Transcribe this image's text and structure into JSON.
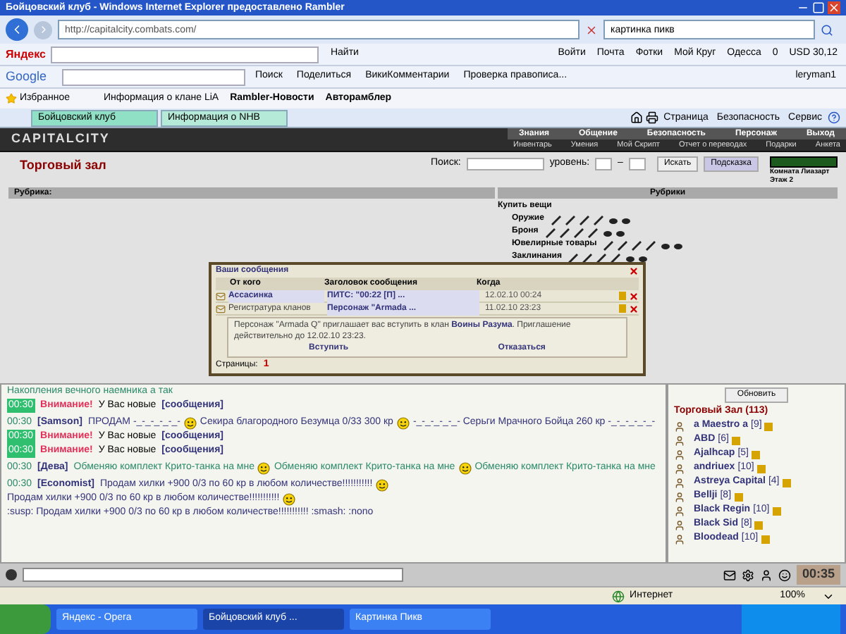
{
  "window": {
    "title": "Бойцовский клуб - Windows Internet Explorer предоставлено Rambler"
  },
  "address_bar": {
    "url": "http://capitalcity.combats.com/",
    "search_value": "картинка пикв"
  },
  "yandex_toolbar": {
    "logo": "Яндекс",
    "button": "Найти",
    "items": [
      "Войти",
      "Почта",
      "Фотки",
      "Мой Круг",
      "Одесса",
      "0",
      "USD 30,12"
    ]
  },
  "google_toolbar": {
    "logo": "Google",
    "items": [
      "Поиск",
      "Поделиться",
      "ВикиКомментарии",
      "Проверка правописа...",
      "leryman1"
    ]
  },
  "favorites_bar": {
    "label": "Избранное",
    "links": [
      "Информация о клане LiA",
      "Rambler-Новости",
      "Авторамблер"
    ]
  },
  "tabs": [
    {
      "label": "Бойцовский клуб",
      "selected": true
    },
    {
      "label": "Информация о NHB",
      "selected": false
    }
  ],
  "commands": [
    "Страница",
    "Безопасность",
    "Сервис"
  ],
  "game_header": {
    "logo": "CAPITALCITY",
    "menu": [
      "Знания",
      "Общение",
      "Безопасность",
      "Персонаж",
      "Выход"
    ],
    "submenu": [
      "Инвентарь",
      "Умения",
      "Мой Скрипт",
      "Отчет о переводах",
      "Подарки",
      "Анкета"
    ]
  },
  "shop": {
    "title": "Торговый зал",
    "search_label": "Поиск:",
    "level_label": "уровень:",
    "level_separator": "–",
    "search_button": "Искать",
    "hint_button": "Подсказка",
    "room_links": [
      "Комната Лиазарт",
      "Этаж 2"
    ],
    "left_header": "Рубрика:",
    "right_header": "Рубрики",
    "buy_label": "Купить вещи",
    "categories": [
      "Оружие",
      "Броня",
      "Ювелирные товары",
      "Заклинания"
    ]
  },
  "messages_dialog": {
    "title": "Ваши сообщения",
    "columns": [
      "От кого",
      "Заголовок сообщения",
      "Когда"
    ],
    "rows": [
      {
        "from": "Ассасинка",
        "subject": "ПИТС: \"00:22 [П] ...",
        "when": "12.02.10 00:24",
        "unread": true
      },
      {
        "from": "Регистратура кланов",
        "subject": "Персонаж \"Armada ...",
        "when": "11.02.10 23:23",
        "unread": false
      }
    ],
    "invite_before": "Персонаж \"Armada Q\" приглашает вас вступить в клан ",
    "clan": "Воины Разума",
    "invite_after": ". Приглашение действительно до 12.02.10 23:23.",
    "accept": "Вступить",
    "decline": "Отказаться",
    "pages_label": "Страницы:",
    "page": "1"
  },
  "chat": {
    "lines": [
      {
        "kind": "notice",
        "text": "Накопления вечного наемника а так"
      },
      {
        "kind": "alert",
        "time": "00:30",
        "label": "Внимание!",
        "text": "У Вас новые",
        "link": "[сообщения]"
      },
      {
        "kind": "message",
        "time": "00:30",
        "nick": "[Samson]",
        "color": "#33337a",
        "parts": [
          "ПРОДАМ -_-_-_-_-_-",
          "Секира благородного Безумца 0/33 300 кр",
          "-_-_-_-_-_- Серьги Мрачного Бойца 260 кр -_-_-_-_-_-"
        ]
      },
      {
        "kind": "alert",
        "time": "00:30",
        "label": "Внимание!",
        "text": "У Вас новые",
        "link": "[сообщения]"
      },
      {
        "kind": "alert",
        "time": "00:30",
        "label": "Внимание!",
        "text": "У Вас новые",
        "link": "[сообщения]"
      },
      {
        "kind": "message",
        "time": "00:30",
        "nick": "[Дева]",
        "color": "#2a8a6a",
        "parts": [
          "Обменяю комплект Крито-танка на мне",
          "Обменяю комплект Крито-танка на мне",
          "Обменяю комплект Крито-танка на мне"
        ]
      },
      {
        "kind": "message",
        "time": "00:30",
        "nick": "[Economist]",
        "color": "#33337a",
        "parts": [
          "Продам хилки +900 0/3 по 60 кр в любом количестве!!!!!!!!!!!",
          "Продам хилки +900 0/3 по 60 кр в любом количестве!!!!!!!!!!!",
          ":susp: Продам хилки +900 0/3 по 60 кр в любом количестве!!!!!!!!!!! :smash: :nono"
        ]
      }
    ]
  },
  "users": {
    "refresh": "Обновить",
    "title": "Торговый Зал (113)",
    "list": [
      {
        "name": "a Maestro a",
        "level": "[9]"
      },
      {
        "name": "ABD",
        "level": "[6]"
      },
      {
        "name": "Ajalhcap",
        "level": "[5]"
      },
      {
        "name": "andriuex",
        "level": "[10]"
      },
      {
        "name": "Astreya Capital",
        "level": "[4]"
      },
      {
        "name": "Bellji",
        "level": "[8]"
      },
      {
        "name": "Black Regin",
        "level": "[10]"
      },
      {
        "name": "Black Sid",
        "level": "[8]"
      },
      {
        "name": "Bloodead",
        "level": "[10]"
      }
    ]
  },
  "chat_toolbar": {
    "clock": "00:35"
  },
  "status_bar": {
    "zone": "Интернет",
    "zoom": "100%"
  },
  "taskbar": {
    "items": [
      {
        "label": "Яндекс - Opera",
        "selected": false
      },
      {
        "label": "Бойцовский клуб ...",
        "selected": true
      },
      {
        "label": "Картинка Пикв",
        "selected": false
      }
    ]
  }
}
